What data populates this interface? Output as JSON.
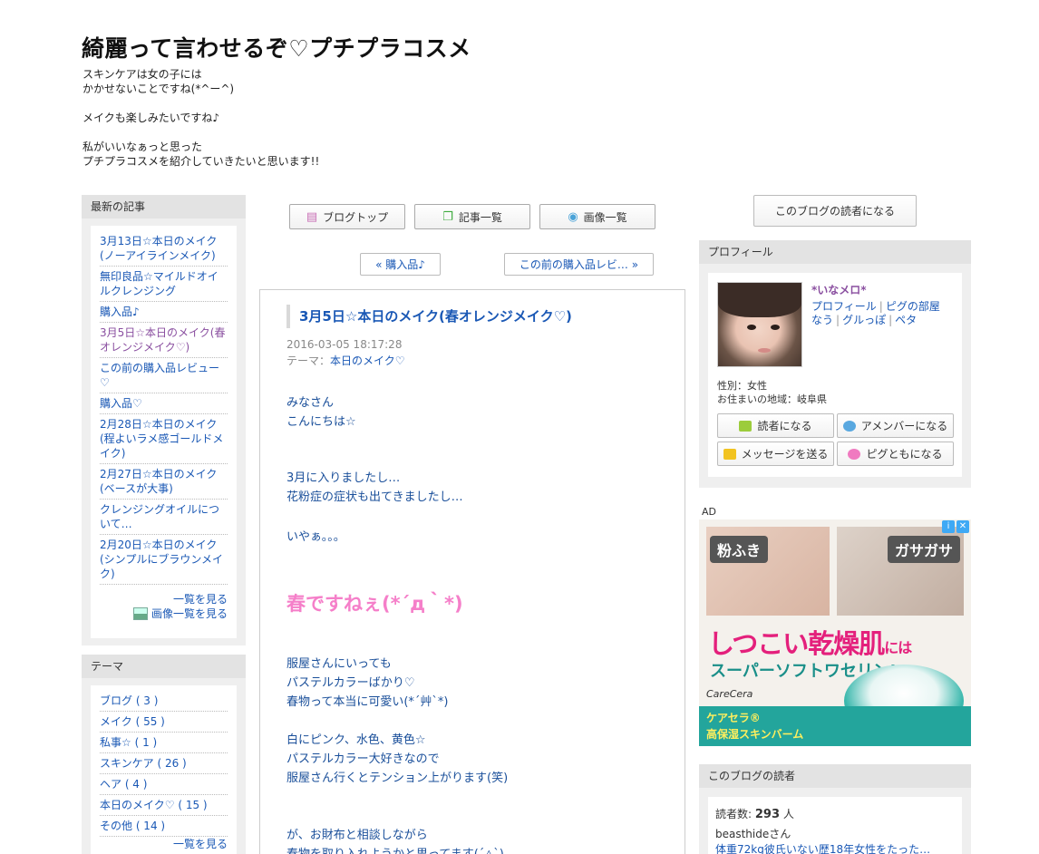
{
  "blog": {
    "title": "綺麗って言わせるぞ♡プチプラコスメ",
    "description": [
      "スキンケアは女の子には",
      "かかせないことですね(*^ー^)",
      "",
      "メイクも楽しみたいですね♪",
      "",
      "私がいいなぁっと思った",
      "プチプラコスメを紹介していきたいと思います!!"
    ]
  },
  "recent": {
    "heading": "最新の記事",
    "items": [
      "3月13日☆本日のメイク(ノーアイラインメイク)",
      "無印良品☆マイルドオイルクレンジング",
      "購入品♪",
      "3月5日☆本日のメイク(春オレンジメイク♡)",
      "この前の購入品レビュー♡",
      "購入品♡",
      "2月28日☆本日のメイク(程よいラメ感ゴールドメイク)",
      "2月27日☆本日のメイク(ベースが大事)",
      "クレンジングオイルについて…",
      "2月20日☆本日のメイク(シンプルにブラウンメイク)"
    ],
    "more": "一覧を見る",
    "image_more": "画像一覧を見る"
  },
  "theme": {
    "heading": "テーマ",
    "items": [
      "ブログ ( 3 )",
      "メイク ( 55 )",
      "私事☆ ( 1 )",
      "スキンケア ( 26 )",
      "ヘア ( 4 )",
      "本日のメイク♡ ( 15 )",
      "その他 ( 14 )"
    ],
    "more": "一覧を見る"
  },
  "nav": {
    "blogtop": "ブログトップ",
    "entrylist": "記事一覧",
    "imagelist": "画像一覧",
    "prev": "« 購入品♪",
    "next": "この前の購入品レビ… »"
  },
  "article": {
    "title": "3月5日☆本日のメイク(春オレンジメイク♡)",
    "date": "2016-03-05 18:17:28",
    "theme_label": "テーマ：",
    "theme_value": "本日のメイク♡",
    "paragraphs": [
      [
        "みなさん",
        "こんにちは☆"
      ],
      [
        "3月に入りましたし…",
        "花粉症の症状も出てきましたし…"
      ],
      [
        "いやぁ。。。"
      ],
      [
        "服屋さんにいっても",
        "パステルカラーばかり♡",
        "春物って本当に可愛い(*´艸`*)"
      ],
      [
        "白にピンク、水色、黄色☆",
        "パステルカラー大好きなので",
        "服屋さん行くとテンション上がります(笑)"
      ],
      [
        "が、お財布と相談しながら",
        "春物を取り入れようかと思ってます(´△`)"
      ]
    ],
    "big_line": "春ですねぇ(*´д｀*)"
  },
  "right": {
    "reader_button": "このブログの読者になる",
    "profile_heading": "プロフィール",
    "profile_name": "*いなメロ*",
    "profile_links": [
      "プロフィール",
      "ピグの部屋",
      "なう",
      "グルっぽ",
      "ペタ"
    ],
    "gender": "性別：女性",
    "location": "お住まいの地域：岐阜県",
    "btn_reader": "読者になる",
    "btn_amember": "アメンバーになる",
    "btn_message": "メッセージを送る",
    "btn_pigg": "ピグともになる",
    "ad_label": "AD",
    "ad": {
      "tag1": "粉ふき",
      "tag2": "ガサガサ",
      "headline": "しつこい乾燥肌",
      "headline_small": "には",
      "sub": "スーパーソフトワセリン!",
      "brand": "CareCera",
      "bar_line1": "ケアセラ®",
      "bar_line2": "高保湿スキンバーム"
    },
    "readers_heading": "このブログの読者",
    "readers_count_label": "読者数:",
    "readers_count": "293",
    "readers_unit": "人",
    "reader_name": "beasthideさん",
    "reader_blog": "体重72kg彼氏いない歴18年女性をたった…"
  },
  "colors": {
    "link": "#1a58b5",
    "visited": "#8a4fa0",
    "accent_pink": "#f57fc9",
    "ad_pink": "#e4207c",
    "ad_teal": "#23a59c"
  }
}
